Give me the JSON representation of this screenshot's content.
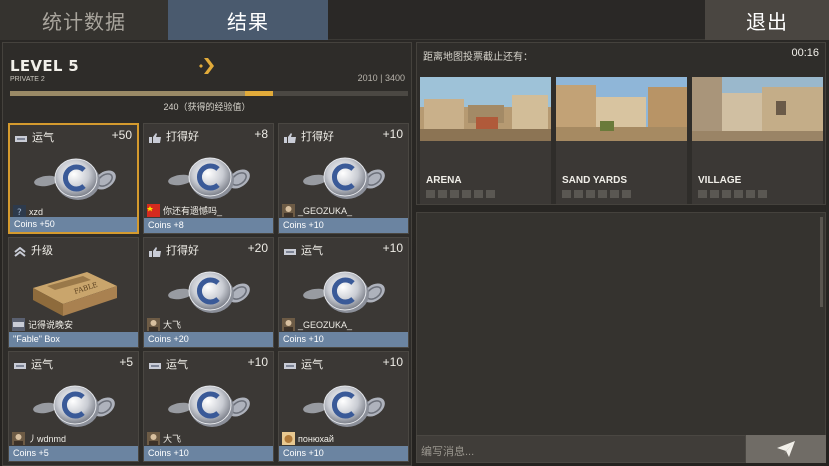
{
  "tabs": {
    "stats": "统计数据",
    "results": "结果",
    "exit": "退出"
  },
  "level": {
    "title": "LEVEL 5",
    "rank": "PRIVATE 2",
    "xp_numbers": "2010 | 3400",
    "xp_label": "240（获得的经验值）",
    "xp_progress": 0.591,
    "xp_gain_fraction": 0.071
  },
  "cards": [
    {
      "type": "运气",
      "points": "+50",
      "icon": "luck-icon",
      "art": "coins",
      "player": "xzd",
      "avatar": "question-avatar",
      "reward": "Coins +50",
      "selected": true
    },
    {
      "type": "打得好",
      "points": "+8",
      "icon": "thumbs-up-icon",
      "art": "coins",
      "player": "你还有遗憾吗_",
      "avatar": "flag-avatar",
      "reward": "Coins +8",
      "selected": false
    },
    {
      "type": "打得好",
      "points": "+10",
      "icon": "thumbs-up-icon",
      "art": "coins",
      "player": "_GEOZUKA_",
      "avatar": "portrait-avatar",
      "reward": "Coins +10",
      "selected": false
    },
    {
      "type": "升级",
      "points": "",
      "icon": "level-up-icon",
      "art": "box",
      "player": "记得说晚安",
      "avatar": "luck-avatar",
      "reward": "\"Fable\" Box",
      "selected": false
    },
    {
      "type": "打得好",
      "points": "+20",
      "icon": "thumbs-up-icon",
      "art": "coins",
      "player": "大飞",
      "avatar": "portrait-avatar",
      "reward": "Coins +20",
      "selected": false
    },
    {
      "type": "运气",
      "points": "+10",
      "icon": "luck-icon",
      "art": "coins",
      "player": "_GEOZUKA_",
      "avatar": "portrait-avatar",
      "reward": "Coins +10",
      "selected": false
    },
    {
      "type": "运气",
      "points": "+5",
      "icon": "luck-icon",
      "art": "coins",
      "player": "丿wdnmd",
      "avatar": "portrait-avatar",
      "reward": "Coins +5",
      "selected": false
    },
    {
      "type": "运气",
      "points": "+10",
      "icon": "luck-icon",
      "art": "coins",
      "player": "大飞",
      "avatar": "portrait-avatar",
      "reward": "Coins +10",
      "selected": false
    },
    {
      "type": "运气",
      "points": "+10",
      "icon": "luck-icon",
      "art": "coins",
      "player": "понюхай",
      "avatar": "cat-avatar",
      "reward": "Coins +10",
      "selected": false
    }
  ],
  "vote": {
    "label": "距离地图投票截止还有：",
    "timer": "00:16",
    "maps": [
      {
        "name": "ARENA",
        "votes": 0,
        "slots": 6
      },
      {
        "name": "SAND YARDS",
        "votes": 0,
        "slots": 6
      },
      {
        "name": "VILLAGE",
        "votes": 0,
        "slots": 6
      }
    ]
  },
  "chat": {
    "placeholder": "编写消息..."
  },
  "colors": {
    "accent": "#d49a2e",
    "tab_active": "#4a5a6e",
    "card_footer": "#6b84a1",
    "xp_gain": "#e2ab3a"
  }
}
